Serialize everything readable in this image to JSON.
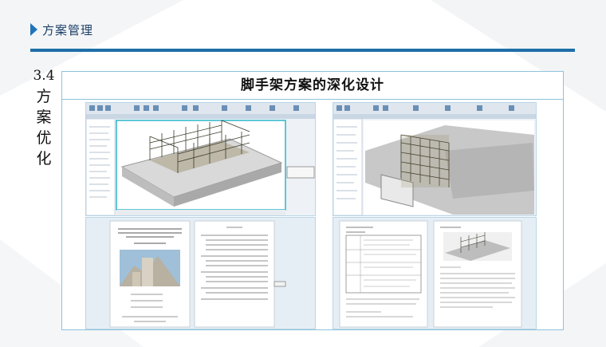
{
  "header": {
    "title": "方案管理"
  },
  "section": {
    "number": "3.4",
    "chars": [
      "方",
      "案",
      "优",
      "化"
    ]
  },
  "panel": {
    "title": "脚手架方案的深化设计"
  },
  "images": [
    {
      "name": "revit-scaffold-model-1"
    },
    {
      "name": "revit-scaffold-model-2"
    },
    {
      "name": "scaffold-plan-document-cover"
    },
    {
      "name": "scaffold-plan-document-pages"
    }
  ],
  "colors": {
    "accent": "#1e6fa8",
    "frame_border": "#8ec2dc",
    "header_text": "#1c3f66"
  }
}
